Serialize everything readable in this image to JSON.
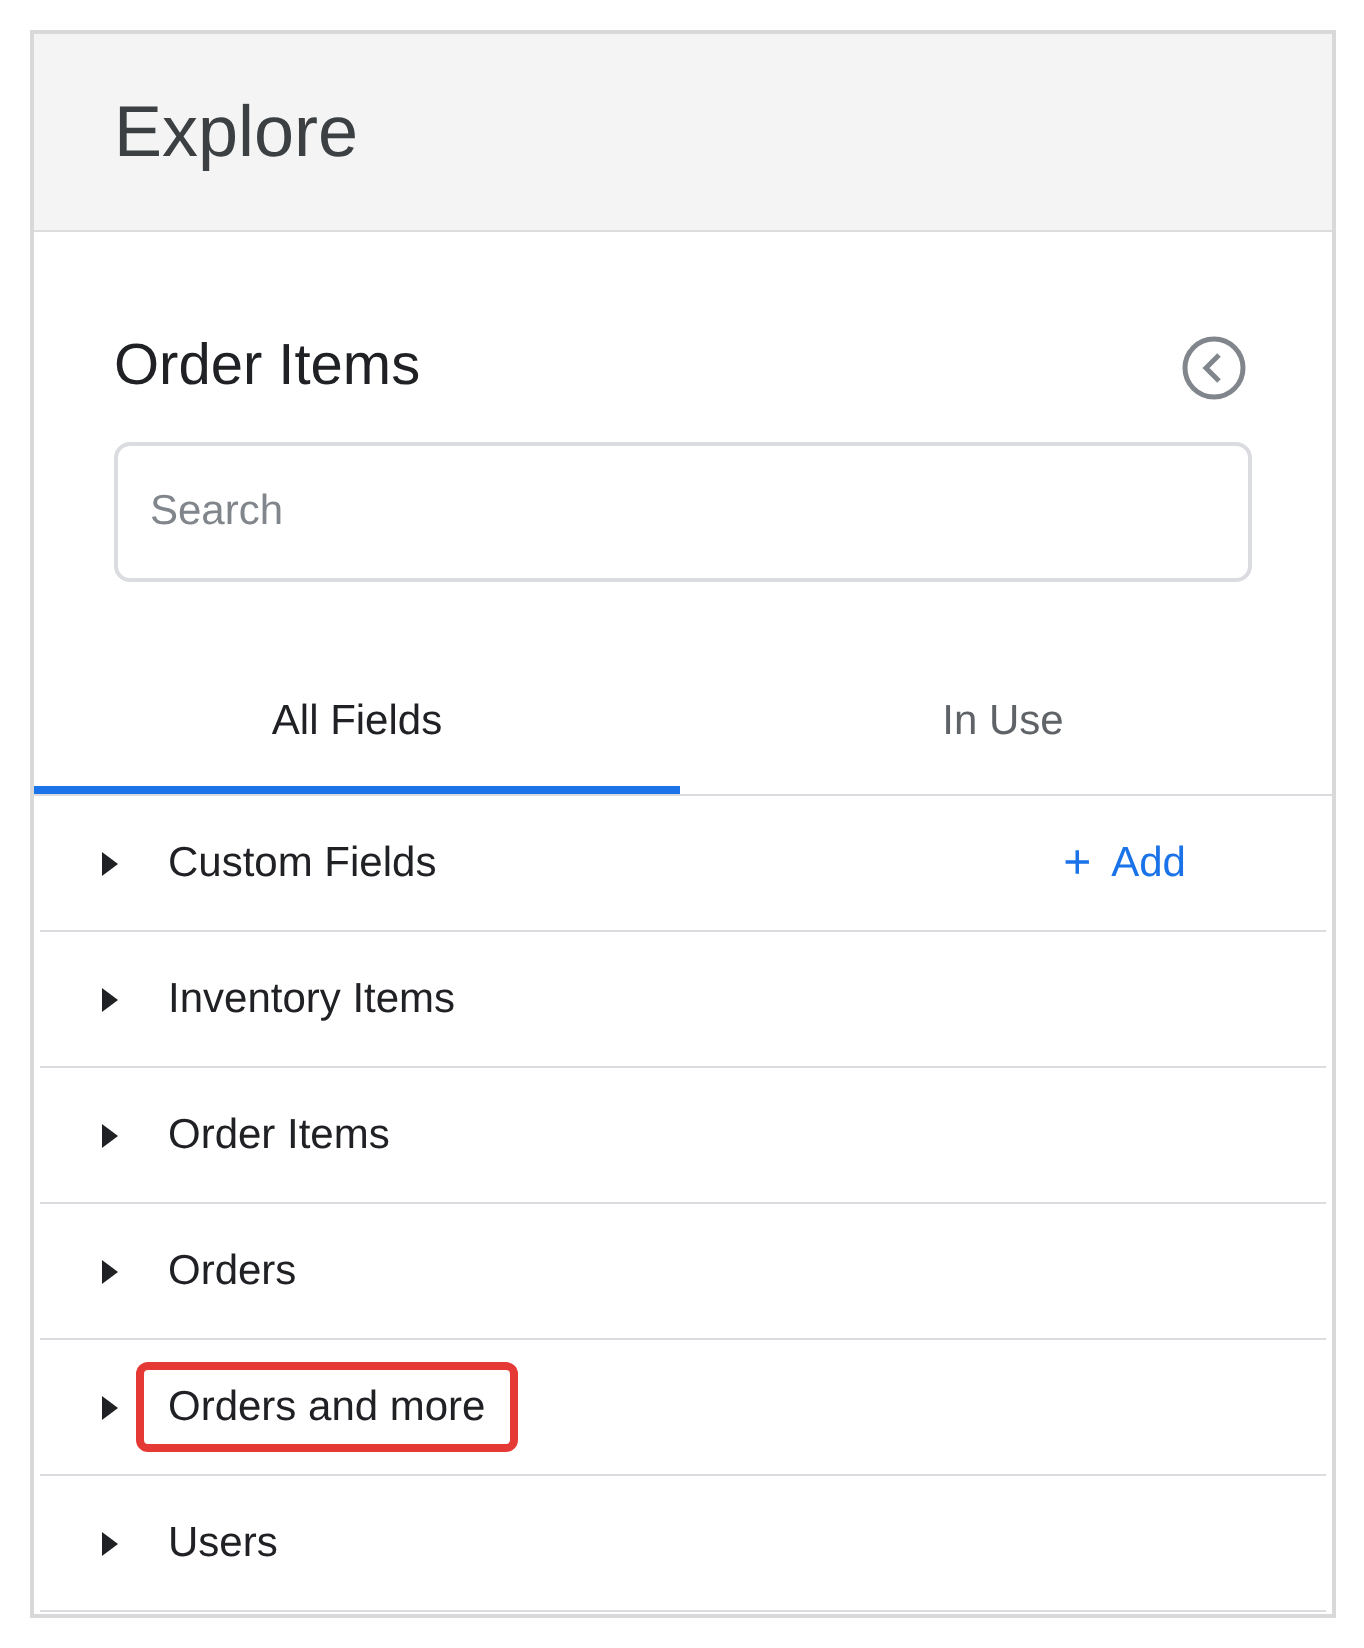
{
  "header": {
    "title": "Explore"
  },
  "panel": {
    "title": "Order Items"
  },
  "search": {
    "placeholder": "Search"
  },
  "tabs": [
    {
      "label": "All Fields",
      "selected": true
    },
    {
      "label": "In Use",
      "selected": false
    }
  ],
  "groups": [
    {
      "label": "Custom Fields",
      "expanded": false,
      "highlighted": false,
      "action": {
        "icon": "+",
        "label": "Add"
      }
    },
    {
      "label": "Inventory Items",
      "expanded": false,
      "highlighted": false
    },
    {
      "label": "Order Items",
      "expanded": false,
      "highlighted": false
    },
    {
      "label": "Orders",
      "expanded": false,
      "highlighted": false
    },
    {
      "label": "Orders and more",
      "expanded": false,
      "highlighted": true
    },
    {
      "label": "Users",
      "expanded": false,
      "highlighted": false
    }
  ]
}
